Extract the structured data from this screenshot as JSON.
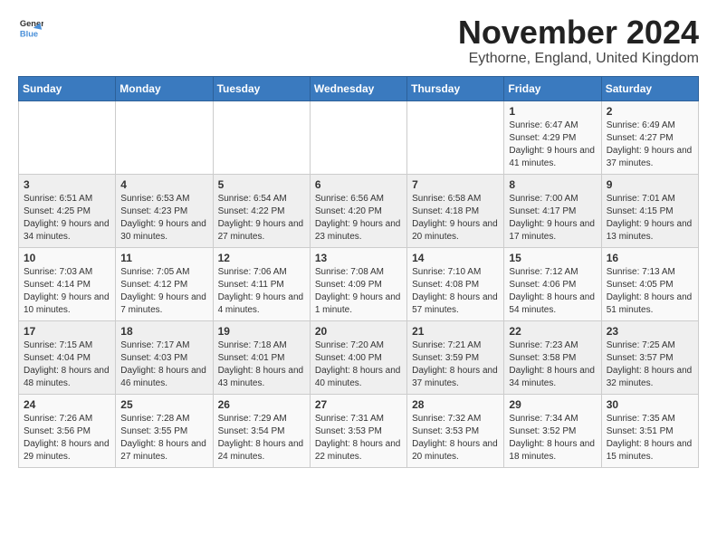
{
  "logo": {
    "general": "General",
    "blue": "Blue"
  },
  "header": {
    "month": "November 2024",
    "location": "Eythorne, England, United Kingdom"
  },
  "weekdays": [
    "Sunday",
    "Monday",
    "Tuesday",
    "Wednesday",
    "Thursday",
    "Friday",
    "Saturday"
  ],
  "weeks": [
    [
      {
        "day": "",
        "sunrise": "",
        "sunset": "",
        "daylight": ""
      },
      {
        "day": "",
        "sunrise": "",
        "sunset": "",
        "daylight": ""
      },
      {
        "day": "",
        "sunrise": "",
        "sunset": "",
        "daylight": ""
      },
      {
        "day": "",
        "sunrise": "",
        "sunset": "",
        "daylight": ""
      },
      {
        "day": "",
        "sunrise": "",
        "sunset": "",
        "daylight": ""
      },
      {
        "day": "1",
        "sunrise": "Sunrise: 6:47 AM",
        "sunset": "Sunset: 4:29 PM",
        "daylight": "Daylight: 9 hours and 41 minutes."
      },
      {
        "day": "2",
        "sunrise": "Sunrise: 6:49 AM",
        "sunset": "Sunset: 4:27 PM",
        "daylight": "Daylight: 9 hours and 37 minutes."
      }
    ],
    [
      {
        "day": "3",
        "sunrise": "Sunrise: 6:51 AM",
        "sunset": "Sunset: 4:25 PM",
        "daylight": "Daylight: 9 hours and 34 minutes."
      },
      {
        "day": "4",
        "sunrise": "Sunrise: 6:53 AM",
        "sunset": "Sunset: 4:23 PM",
        "daylight": "Daylight: 9 hours and 30 minutes."
      },
      {
        "day": "5",
        "sunrise": "Sunrise: 6:54 AM",
        "sunset": "Sunset: 4:22 PM",
        "daylight": "Daylight: 9 hours and 27 minutes."
      },
      {
        "day": "6",
        "sunrise": "Sunrise: 6:56 AM",
        "sunset": "Sunset: 4:20 PM",
        "daylight": "Daylight: 9 hours and 23 minutes."
      },
      {
        "day": "7",
        "sunrise": "Sunrise: 6:58 AM",
        "sunset": "Sunset: 4:18 PM",
        "daylight": "Daylight: 9 hours and 20 minutes."
      },
      {
        "day": "8",
        "sunrise": "Sunrise: 7:00 AM",
        "sunset": "Sunset: 4:17 PM",
        "daylight": "Daylight: 9 hours and 17 minutes."
      },
      {
        "day": "9",
        "sunrise": "Sunrise: 7:01 AM",
        "sunset": "Sunset: 4:15 PM",
        "daylight": "Daylight: 9 hours and 13 minutes."
      }
    ],
    [
      {
        "day": "10",
        "sunrise": "Sunrise: 7:03 AM",
        "sunset": "Sunset: 4:14 PM",
        "daylight": "Daylight: 9 hours and 10 minutes."
      },
      {
        "day": "11",
        "sunrise": "Sunrise: 7:05 AM",
        "sunset": "Sunset: 4:12 PM",
        "daylight": "Daylight: 9 hours and 7 minutes."
      },
      {
        "day": "12",
        "sunrise": "Sunrise: 7:06 AM",
        "sunset": "Sunset: 4:11 PM",
        "daylight": "Daylight: 9 hours and 4 minutes."
      },
      {
        "day": "13",
        "sunrise": "Sunrise: 7:08 AM",
        "sunset": "Sunset: 4:09 PM",
        "daylight": "Daylight: 9 hours and 1 minute."
      },
      {
        "day": "14",
        "sunrise": "Sunrise: 7:10 AM",
        "sunset": "Sunset: 4:08 PM",
        "daylight": "Daylight: 8 hours and 57 minutes."
      },
      {
        "day": "15",
        "sunrise": "Sunrise: 7:12 AM",
        "sunset": "Sunset: 4:06 PM",
        "daylight": "Daylight: 8 hours and 54 minutes."
      },
      {
        "day": "16",
        "sunrise": "Sunrise: 7:13 AM",
        "sunset": "Sunset: 4:05 PM",
        "daylight": "Daylight: 8 hours and 51 minutes."
      }
    ],
    [
      {
        "day": "17",
        "sunrise": "Sunrise: 7:15 AM",
        "sunset": "Sunset: 4:04 PM",
        "daylight": "Daylight: 8 hours and 48 minutes."
      },
      {
        "day": "18",
        "sunrise": "Sunrise: 7:17 AM",
        "sunset": "Sunset: 4:03 PM",
        "daylight": "Daylight: 8 hours and 46 minutes."
      },
      {
        "day": "19",
        "sunrise": "Sunrise: 7:18 AM",
        "sunset": "Sunset: 4:01 PM",
        "daylight": "Daylight: 8 hours and 43 minutes."
      },
      {
        "day": "20",
        "sunrise": "Sunrise: 7:20 AM",
        "sunset": "Sunset: 4:00 PM",
        "daylight": "Daylight: 8 hours and 40 minutes."
      },
      {
        "day": "21",
        "sunrise": "Sunrise: 7:21 AM",
        "sunset": "Sunset: 3:59 PM",
        "daylight": "Daylight: 8 hours and 37 minutes."
      },
      {
        "day": "22",
        "sunrise": "Sunrise: 7:23 AM",
        "sunset": "Sunset: 3:58 PM",
        "daylight": "Daylight: 8 hours and 34 minutes."
      },
      {
        "day": "23",
        "sunrise": "Sunrise: 7:25 AM",
        "sunset": "Sunset: 3:57 PM",
        "daylight": "Daylight: 8 hours and 32 minutes."
      }
    ],
    [
      {
        "day": "24",
        "sunrise": "Sunrise: 7:26 AM",
        "sunset": "Sunset: 3:56 PM",
        "daylight": "Daylight: 8 hours and 29 minutes."
      },
      {
        "day": "25",
        "sunrise": "Sunrise: 7:28 AM",
        "sunset": "Sunset: 3:55 PM",
        "daylight": "Daylight: 8 hours and 27 minutes."
      },
      {
        "day": "26",
        "sunrise": "Sunrise: 7:29 AM",
        "sunset": "Sunset: 3:54 PM",
        "daylight": "Daylight: 8 hours and 24 minutes."
      },
      {
        "day": "27",
        "sunrise": "Sunrise: 7:31 AM",
        "sunset": "Sunset: 3:53 PM",
        "daylight": "Daylight: 8 hours and 22 minutes."
      },
      {
        "day": "28",
        "sunrise": "Sunrise: 7:32 AM",
        "sunset": "Sunset: 3:53 PM",
        "daylight": "Daylight: 8 hours and 20 minutes."
      },
      {
        "day": "29",
        "sunrise": "Sunrise: 7:34 AM",
        "sunset": "Sunset: 3:52 PM",
        "daylight": "Daylight: 8 hours and 18 minutes."
      },
      {
        "day": "30",
        "sunrise": "Sunrise: 7:35 AM",
        "sunset": "Sunset: 3:51 PM",
        "daylight": "Daylight: 8 hours and 15 minutes."
      }
    ]
  ]
}
